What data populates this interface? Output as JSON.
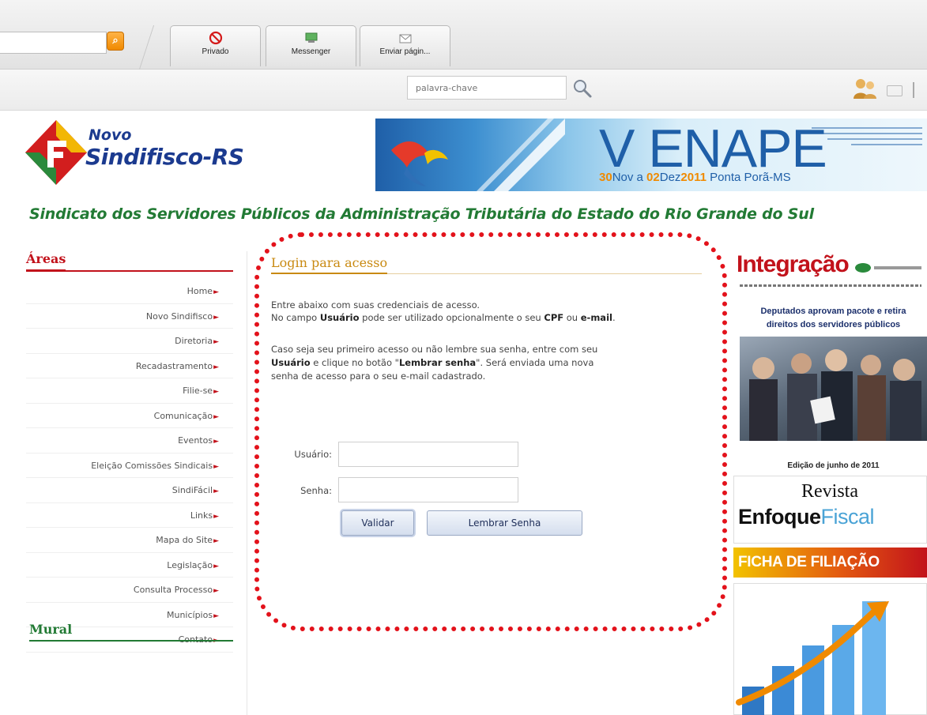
{
  "toolbar": {
    "go_icon": "search-go-icon",
    "buttons": [
      {
        "label": "Privado",
        "icon": "privacy-icon"
      },
      {
        "label": "Messenger",
        "icon": "messenger-icon"
      },
      {
        "label": "Enviar págin...",
        "icon": "send-page-icon"
      }
    ],
    "keyword_placeholder": "palavra-chave",
    "search_icon": "magnifier-icon",
    "user_icon": "users-icon"
  },
  "header": {
    "logo_prefix": "Novo",
    "logo_name": "Sindifisco-RS",
    "banner": {
      "title": "V ENAPE",
      "date_a": "30",
      "date_b": "Nov a ",
      "date_c": "02",
      "date_d": "Dez",
      "date_e": "2011",
      "date_f": " Ponta Porã-MS"
    },
    "tagline": "Sindicato dos Servidores Públicos da Administração Tributária do Estado do Rio Grande do Sul"
  },
  "sidebar": {
    "title": "Áreas",
    "items": [
      "Home",
      "Novo Sindifisco",
      "Diretoria",
      "Recadastramento",
      "Filie-se",
      "Comunicação",
      "Eventos",
      "Eleição Comissões Sindicais",
      "SindiFácil",
      "Links",
      "Mapa do Site",
      "Legislação",
      "Consulta Processo",
      "Municípios",
      "Contato"
    ],
    "arrow": "►",
    "mural_title": "Mural"
  },
  "login": {
    "title": "Login para acesso",
    "line1": "Entre abaixo com suas credenciais de acesso.",
    "line2_a": "No campo ",
    "line2_b": "Usuário",
    "line2_c": " pode ser utilizado opcionalmente o seu ",
    "line2_d": "CPF",
    "line2_e": " ou ",
    "line2_f": "e-mail",
    "line2_g": ".",
    "line3": "Caso seja seu primeiro acesso ou não lembre sua senha, entre com seu",
    "line4_a": "Usuário",
    "line4_b": " e clique no botão \"",
    "line4_c": "Lembrar senha",
    "line4_d": "\". Será enviada uma nova",
    "line5": "senha de acesso para o seu e-mail cadastrado.",
    "user_label": "Usuário:",
    "user_value": "",
    "pass_label": "Senha:",
    "pass_value": "",
    "validate_button": "Validar",
    "remind_button": "Lembrar Senha"
  },
  "right": {
    "integracao_title": "Integração",
    "integracao_headline_1": "Deputados aprovam pacote e retira",
    "integracao_headline_2": "direitos dos servidores públicos",
    "integracao_caption": "Edição de junho de 2011",
    "revista_label": "Revista",
    "revista_name_a": "Enfoque",
    "revista_name_b": "Fiscal",
    "ficha_label": "FICHA DE FILIAÇÃO"
  },
  "colors": {
    "brand_red": "#c2121b",
    "brand_green": "#227a34",
    "brand_blue": "#1b3a8f",
    "highlight_dotted_border": "#e3121b",
    "login_title": "#c98a12"
  }
}
